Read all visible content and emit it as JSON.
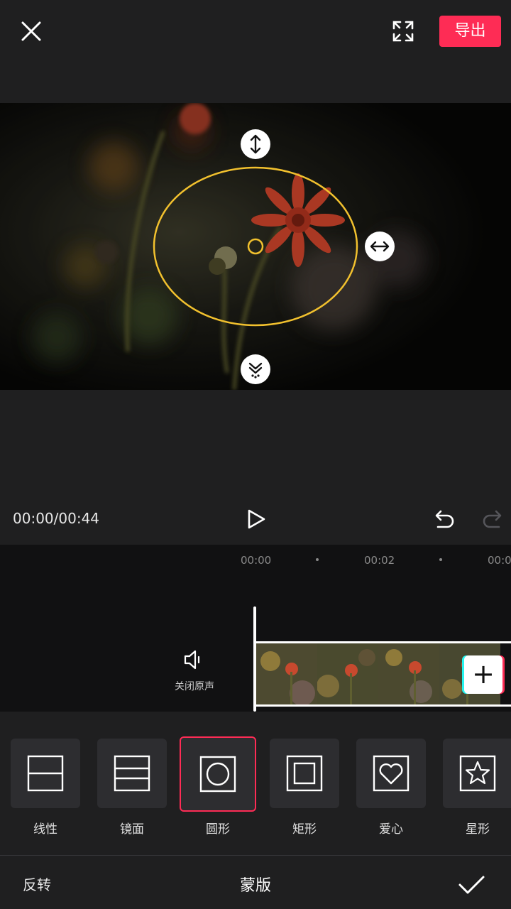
{
  "topbar": {
    "export_label": "导出"
  },
  "player": {
    "time": "00:00/00:44"
  },
  "timeline": {
    "ticks": [
      "00:00",
      "00:02",
      "00:0"
    ],
    "mute_label": "关闭原声"
  },
  "masks": {
    "items": [
      {
        "label": "线性",
        "icon": "linear-mask-icon"
      },
      {
        "label": "镜面",
        "icon": "mirror-mask-icon"
      },
      {
        "label": "圆形",
        "icon": "circle-mask-icon",
        "selected": true
      },
      {
        "label": "矩形",
        "icon": "rectangle-mask-icon"
      },
      {
        "label": "爱心",
        "icon": "heart-mask-icon"
      },
      {
        "label": "星形",
        "icon": "star-mask-icon"
      }
    ]
  },
  "bottombar": {
    "reverse_label": "反转",
    "title": "蒙版"
  },
  "colors": {
    "accent": "#fe2c55",
    "mask_outline": "#f2c12e",
    "background": "#1f1f20"
  }
}
